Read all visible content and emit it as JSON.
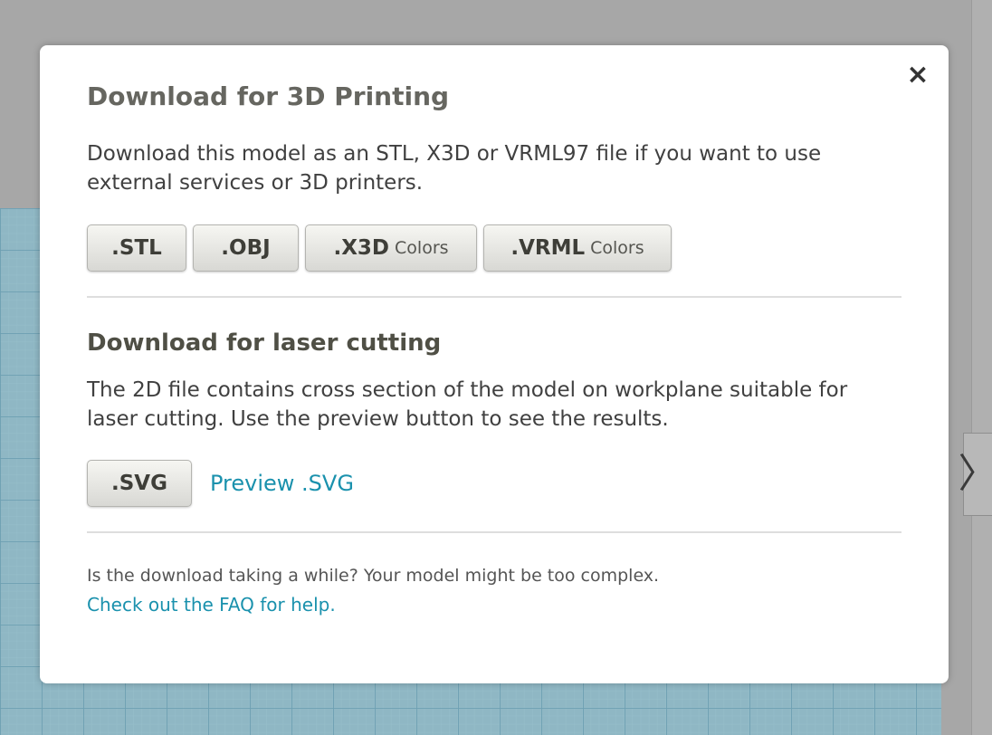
{
  "modal": {
    "close_icon": "×",
    "section_3d": {
      "title": "Download for 3D Printing",
      "description": "Download this model as an STL, X3D or VRML97 file if you want to use external services or 3D printers.",
      "buttons": [
        {
          "label": ".STL",
          "sub": ""
        },
        {
          "label": ".OBJ",
          "sub": ""
        },
        {
          "label": ".X3D",
          "sub": "Colors"
        },
        {
          "label": ".VRML",
          "sub": "Colors"
        }
      ]
    },
    "section_laser": {
      "title": "Download for laser cutting",
      "description": "The 2D file contains cross section of the model on workplane suitable for laser cutting. Use the preview button to see the results.",
      "svg_button": ".SVG",
      "preview_link": "Preview .SVG"
    },
    "footer": {
      "note": "Is the download taking a while? Your model might be too complex.",
      "faq_link": "Check out the FAQ for help."
    }
  },
  "side_panel": {
    "toggle_icon": "〉"
  },
  "colors": {
    "link": "#1a91ad",
    "grid": "#8fb7c4"
  }
}
